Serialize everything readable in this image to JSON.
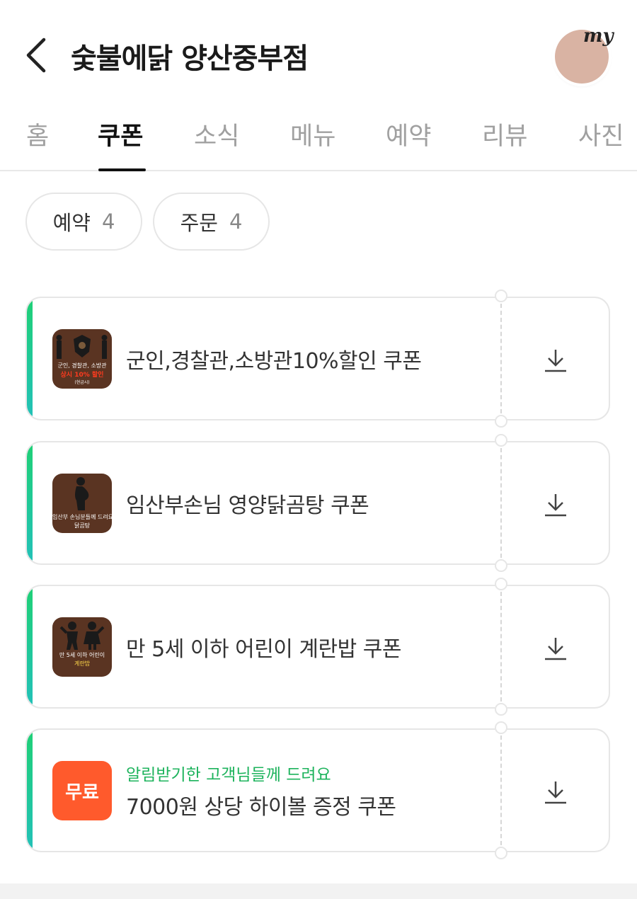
{
  "header": {
    "title": "숯불에닭 양산중부점",
    "avatar_badge": "my"
  },
  "tabs": [
    {
      "label": "홈",
      "active": false
    },
    {
      "label": "쿠폰",
      "active": true
    },
    {
      "label": "소식",
      "active": false
    },
    {
      "label": "메뉴",
      "active": false
    },
    {
      "label": "예약",
      "active": false
    },
    {
      "label": "리뷰",
      "active": false
    },
    {
      "label": "사진",
      "active": false
    }
  ],
  "filters": [
    {
      "label": "예약",
      "count": "4"
    },
    {
      "label": "주문",
      "count": "4"
    }
  ],
  "coupons": [
    {
      "title": "군인,경찰관,소방관10%할인 쿠폰",
      "thumb_lines": [
        "군인, 경찰관, 소방관",
        "상시 10% 할인",
        "(현금시)"
      ]
    },
    {
      "title": "임산부손님 영양닭곰탕 쿠폰",
      "thumb_lines": [
        "임산부 손님분들께 드려요",
        "닭곰탕"
      ]
    },
    {
      "title": "만 5세 이하 어린이 계란밥 쿠폰",
      "thumb_lines": [
        "만 5세 이하 어린이",
        "계란밥"
      ]
    },
    {
      "subtitle": "알림받기한 고객님들께 드려요",
      "title": "7000원 상당 하이볼 증정 쿠폰",
      "thumb_label": "무료"
    }
  ],
  "colors": {
    "accent_green": "#1fd076",
    "free_badge": "#ff5a2c",
    "thumb_brown": "#5a3422"
  },
  "icons": {
    "back": "chevron-left-icon",
    "download": "download-icon"
  }
}
